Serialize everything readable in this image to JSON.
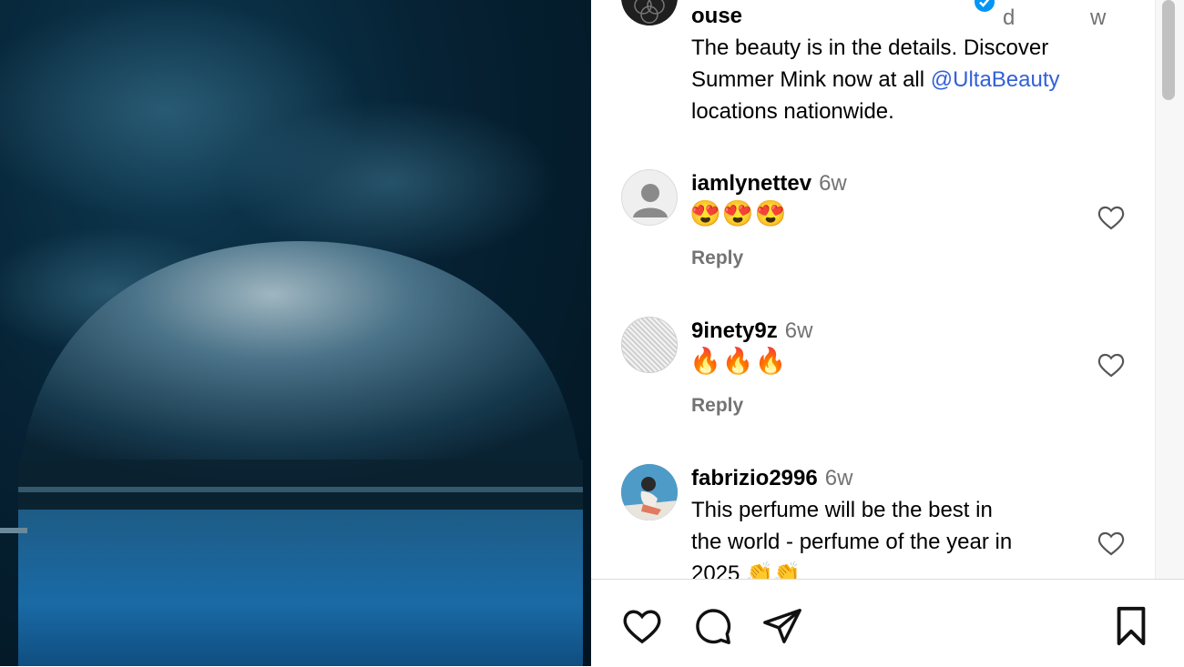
{
  "post": {
    "username_partial": "ouse",
    "meta_left": "d",
    "meta_right": "w",
    "caption_line1": "The beauty is in the details. Discover",
    "caption_line2_prefix": "Summer Mink now at all ",
    "caption_mention": "@UltaBeauty",
    "caption_line3": "locations nationwide."
  },
  "comments": [
    {
      "username": "iamlynettev",
      "time": "6w",
      "text": "😍😍😍",
      "reply": "Reply"
    },
    {
      "username": "9inety9z",
      "time": "6w",
      "text": "🔥🔥🔥",
      "reply": "Reply"
    },
    {
      "username": "fabrizio2996",
      "time": "6w",
      "text_line1": "This perfume will be the best in",
      "text_line2": "the world - perfume of the year in",
      "text_line3": "2025 👏👏"
    }
  ],
  "icons": [
    "heart-icon",
    "comment-icon",
    "share-icon",
    "bookmark-icon",
    "verified-badge-icon"
  ],
  "colors": {
    "link": "#3360d9",
    "muted": "#737373",
    "verified": "#0095f6"
  }
}
